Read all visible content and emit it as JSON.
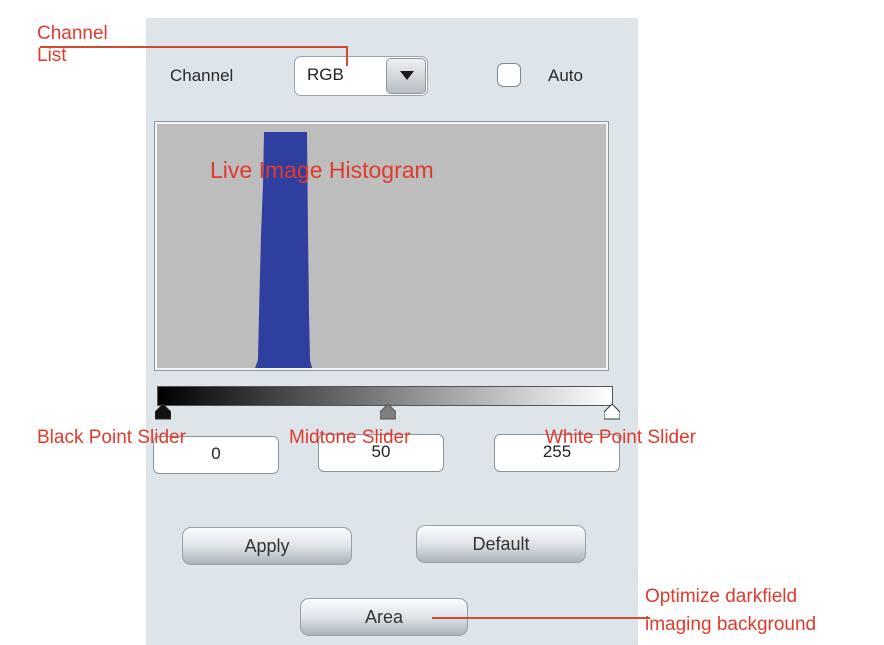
{
  "controls": {
    "channel_label": "Channel",
    "channel_value": "RGB",
    "auto_label": "Auto",
    "auto_checked": false
  },
  "histogram": {
    "bar_color": "#2f3fa0",
    "background_color": "#bdbdbd"
  },
  "levels": {
    "black_point": "0",
    "midtone": "50",
    "white_point": "255"
  },
  "buttons": {
    "apply": "Apply",
    "default": "Default",
    "area": "Area"
  },
  "annotations": {
    "channel_list_line1": "Channel",
    "channel_list_line2": "List",
    "histogram": "Live Image Histogram",
    "black_point": "Black Point Slider",
    "midtone": "Midtone Slider",
    "white_point": "White Point Slider",
    "area_line1": "Optimize darkfield",
    "area_line2": "imaging background",
    "color": "#e03a2c"
  }
}
